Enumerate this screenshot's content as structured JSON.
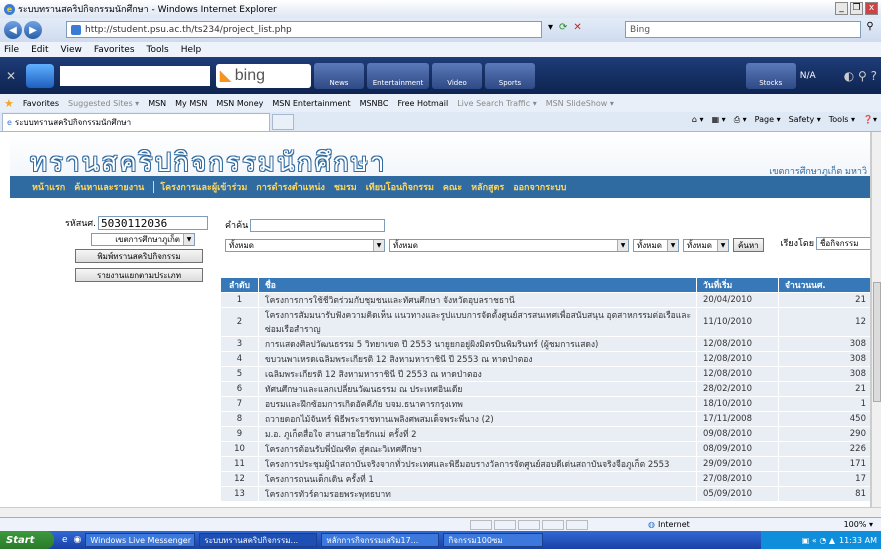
{
  "window": {
    "title": "ระบบทรานสคริปกิจกรรมนักศึกษา - Windows Internet Explorer",
    "controls": [
      "_",
      "❐",
      "x"
    ]
  },
  "browser": {
    "url": "http://student.psu.ac.th/ts234/project_list.php",
    "search_placeholder": "Bing",
    "menu": [
      "File",
      "Edit",
      "View",
      "Favorites",
      "Tools",
      "Help"
    ],
    "bing_logo": "bing",
    "bing_tabs": [
      "News",
      "Entertainment",
      "Video",
      "Sports"
    ],
    "bing_right": [
      "Stocks",
      "N/A"
    ],
    "favorites_label": "Favorites",
    "favorites": [
      "Suggested Sites ▾",
      "MSN",
      "My MSN",
      "MSN Money",
      "MSN Entertainment",
      "MSNBC",
      "Free Hotmail",
      "Live Search Traffic ▾",
      "MSN SlideShow ▾"
    ],
    "tab_title": "ระบบทรานสคริปกิจกรรมนักศึกษา",
    "tab_tools": [
      "Page ▾",
      "Safety ▾",
      "Tools ▾"
    ]
  },
  "site": {
    "title": "ทรานสคริปกิจกรรมนักศึกษา",
    "subtitle": "เขตการศึกษาภูเก็ต มหาวิ",
    "nav": [
      "หน้าแรก",
      "ค้นหาและรายงาน",
      "โครงการและผู้เข้าร่วม",
      "การดำรงตำแหน่ง",
      "ชมรม",
      "เทียบโอนกิจกรรม",
      "คณะ",
      "หลักสูตร",
      "ออกจากระบบ"
    ]
  },
  "sidebar": {
    "student_id_label": "รหัสนศ.",
    "student_id": "5030112036",
    "campus": "เขตการศึกษาภูเก็ต",
    "btn_print": "พิมพ์ทรานสคริปกิจกรรม",
    "btn_report": "รายงานแยกตามประเภท"
  },
  "filters": {
    "keyword_label": "คำค้น",
    "keyword_value": "",
    "sort_label": "เรียงโดย",
    "sort_value": "ชื่อกิจกรรม",
    "select1": "ทั้งหมด",
    "select2": "ทั้งหมด",
    "select3": "ทั้งหมด",
    "select4": "ทั้งหมด",
    "search_button": "ค้นหา"
  },
  "table": {
    "headers": [
      "ลำดับ",
      "ชื่อ",
      "วันที่เริ่ม",
      "จำนวนนศ."
    ],
    "rows": [
      [
        "1",
        "โครงการการใช้ชีวิตร่วมกับชุมชนและทัศนศึกษา จังหวัดอุบลราชธานี",
        "20/04/2010",
        "21"
      ],
      [
        "2",
        "โครงการสัมมนารับฟังความคิดเห็น แนวทางและรูปแบบการจัดตั้งศูนย์สารสนเทศเพื่อสนับสนุน อุตสาหกรรมต่อเรือและซ่อมเรือสำราญ",
        "11/10/2010",
        "12"
      ],
      [
        "3",
        "การแสดงศิลปวัฒนธรรม 5 วิทยาเขต ปี 2553 นายูยกอยู่ผิงมิตรบินพิมรินทร์ (ผู้ชมการแสดง)",
        "12/08/2010",
        "308"
      ],
      [
        "4",
        "ขบวนพาเหรดเฉลิมพระเกียรติ 12 สิงหามหาราชินี ปี 2553 ณ หาดป่าตอง",
        "12/08/2010",
        "308"
      ],
      [
        "5",
        "เฉลิมพระเกียรติ 12 สิงหามหาราชินี ปี 2553 ณ หาดป่าตอง",
        "12/08/2010",
        "308"
      ],
      [
        "6",
        "ทัศนศึกษาและแลกเปลี่ยนวัฒนธรรม ณ ประเทศอินเดีย",
        "28/02/2010",
        "21"
      ],
      [
        "7",
        "อบรมและฝึกซ้อมการเกิดอัคคีภัย บจม.ธนาคารกรุงเทพ",
        "18/10/2010",
        "1"
      ],
      [
        "8",
        "ถวายดอกไม้จันทร์ พิธีพระราชทานเพลิงศพสมเด็จพระพี่นาง (2)",
        "17/11/2008",
        "450"
      ],
      [
        "9",
        "ม.อ. ภูเก็ตสื่อใจ สานสายใยรักแม่ ครั้งที่ 2",
        "09/08/2010",
        "290"
      ],
      [
        "10",
        "โครงการต้อนรับพี่บัณฑิต สู่คณะวิเทศศึกษา",
        "08/09/2010",
        "226"
      ],
      [
        "11",
        "โครงการประชุมผู้นำสถาบันจริงจากทั่วประเทศและพิธีมอบรางวัลการจัดศูนย์สอบดีเด่นสถาบันจริงจือภูเก็ต 2553",
        "29/09/2010",
        "171"
      ],
      [
        "12",
        "โครงการถนนเด็กเดิน ครั้งที่ 1",
        "27/08/2010",
        "17"
      ],
      [
        "13",
        "โครงการทัวร์ตามรอยพระพุทธบาท",
        "05/09/2010",
        "81"
      ]
    ]
  },
  "status": {
    "zone": "Internet",
    "zoom": "100%"
  },
  "taskbar": {
    "start": "Start",
    "tasks": [
      "Windows Live Messenger",
      "ระบบทรานสคริปกิจกรรม...",
      "หลักการกิจกรรมเสริม17...",
      "กิจกรรม100ซม"
    ],
    "clock": "11:33 AM"
  }
}
